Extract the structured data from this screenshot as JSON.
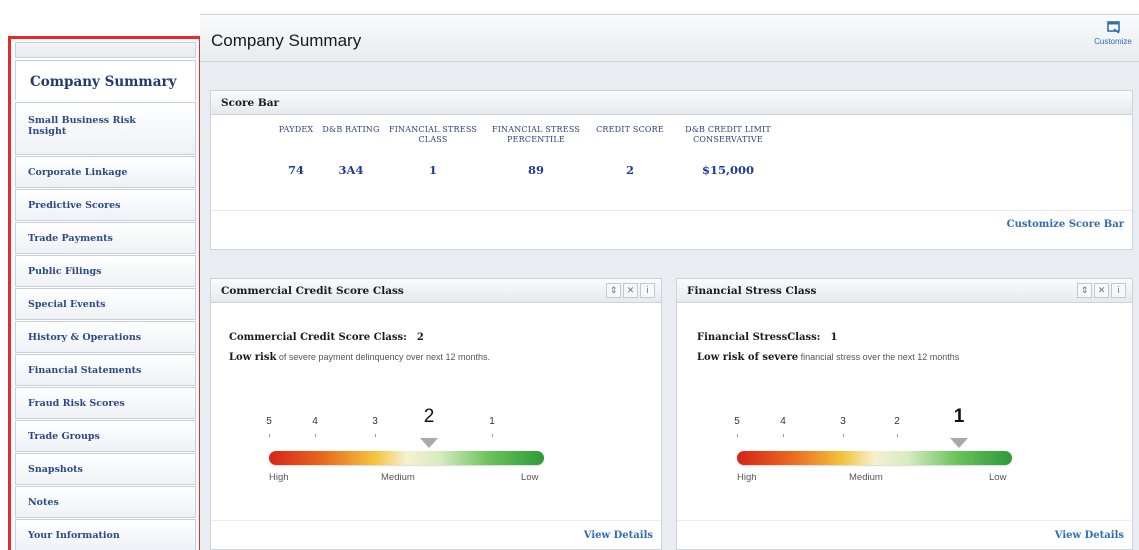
{
  "header": {
    "title": "Company Summary",
    "customize_label": "Customize"
  },
  "sidebar": {
    "active_item": "Company Summary",
    "items": [
      {
        "label": "Small Business Risk Insight"
      },
      {
        "label": "Corporate Linkage"
      },
      {
        "label": "Predictive Scores"
      },
      {
        "label": "Trade Payments"
      },
      {
        "label": "Public Filings"
      },
      {
        "label": "Special Events"
      },
      {
        "label": "History & Operations"
      },
      {
        "label": "Financial Statements"
      },
      {
        "label": "Fraud Risk Scores"
      },
      {
        "label": "Trade Groups"
      },
      {
        "label": "Snapshots"
      },
      {
        "label": "Notes"
      },
      {
        "label": "Your Information"
      }
    ]
  },
  "score_bar": {
    "title": "Score Bar",
    "columns": [
      {
        "label": "PAYDEX",
        "value": "74"
      },
      {
        "label": "D&B RATING",
        "value": "3A4"
      },
      {
        "label": "FINANCIAL STRESS CLASS",
        "value": "1"
      },
      {
        "label": "FINANCIAL STRESS PERCENTILE",
        "value": "89"
      },
      {
        "label": "CREDIT SCORE",
        "value": "2"
      },
      {
        "label": "D&B CREDIT LIMIT CONSERVATIVE",
        "value": "$15,000"
      }
    ],
    "customize_link": "Customize Score Bar"
  },
  "commercial_panel": {
    "title": "Commercial Credit Score Class",
    "metric_label": "Commercial Credit Score Class:",
    "metric_value": "2",
    "desc_bold": "Low risk",
    "desc_rest": " of severe payment delinquency over next 12 months.",
    "scale": [
      "5",
      "4",
      "3",
      "2",
      "1"
    ],
    "selected": "2",
    "scale_labels": {
      "high": "High",
      "medium": "Medium",
      "low": "Low"
    },
    "view_details": "View Details"
  },
  "stress_panel": {
    "title": "Financial Stress Class",
    "metric_label": "Financial StressClass:",
    "metric_value": "1",
    "desc_bold": "Low risk of severe",
    "desc_rest": " financial stress over the next 12 months",
    "scale": [
      "5",
      "4",
      "3",
      "2",
      "1"
    ],
    "selected": "1",
    "scale_labels": {
      "high": "High",
      "medium": "Medium",
      "low": "Low"
    },
    "view_details": "View Details"
  },
  "tools": {
    "move_icon": "move-icon",
    "close_icon": "close-icon",
    "info_icon": "info-icon"
  }
}
